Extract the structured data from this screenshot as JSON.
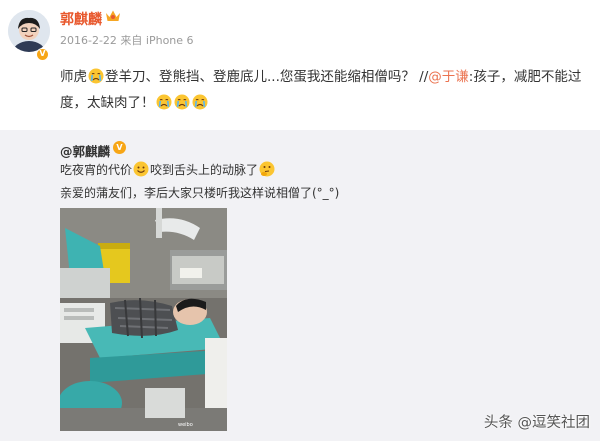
{
  "post": {
    "author": "郭麒麟",
    "meta": "2016-2-22 来自 iPhone 6",
    "text_1": "师虎",
    "text_2": "登羊刀、登熊挡、登鹿底儿...您蛋我还能缩相僧吗？ //",
    "mention": "@于谦",
    "text_3": ":孩子，减肥不能过度，太缺肉了！"
  },
  "repost": {
    "author": "@郭麒麟",
    "line1_a": "吃夜宵的代价",
    "line1_b": "咬到舌头上的动脉了",
    "line2": "亲爱的蒲友们，李后大家只楼听我这样说相僧了(°_°)"
  },
  "watermark": "头条 @逗笑社团",
  "icons": {
    "crying_emoji": "crying-face-emoji",
    "smile_emoji": "smile-face-emoji",
    "thinking_emoji": "thinking-face-emoji",
    "verified_badge": "verified-v-badge",
    "crown": "crown-icon"
  },
  "colors": {
    "username": "#e8582d",
    "mention": "#eb7350",
    "repost_bg": "#f2f2f5",
    "badge": "#f7a616"
  }
}
